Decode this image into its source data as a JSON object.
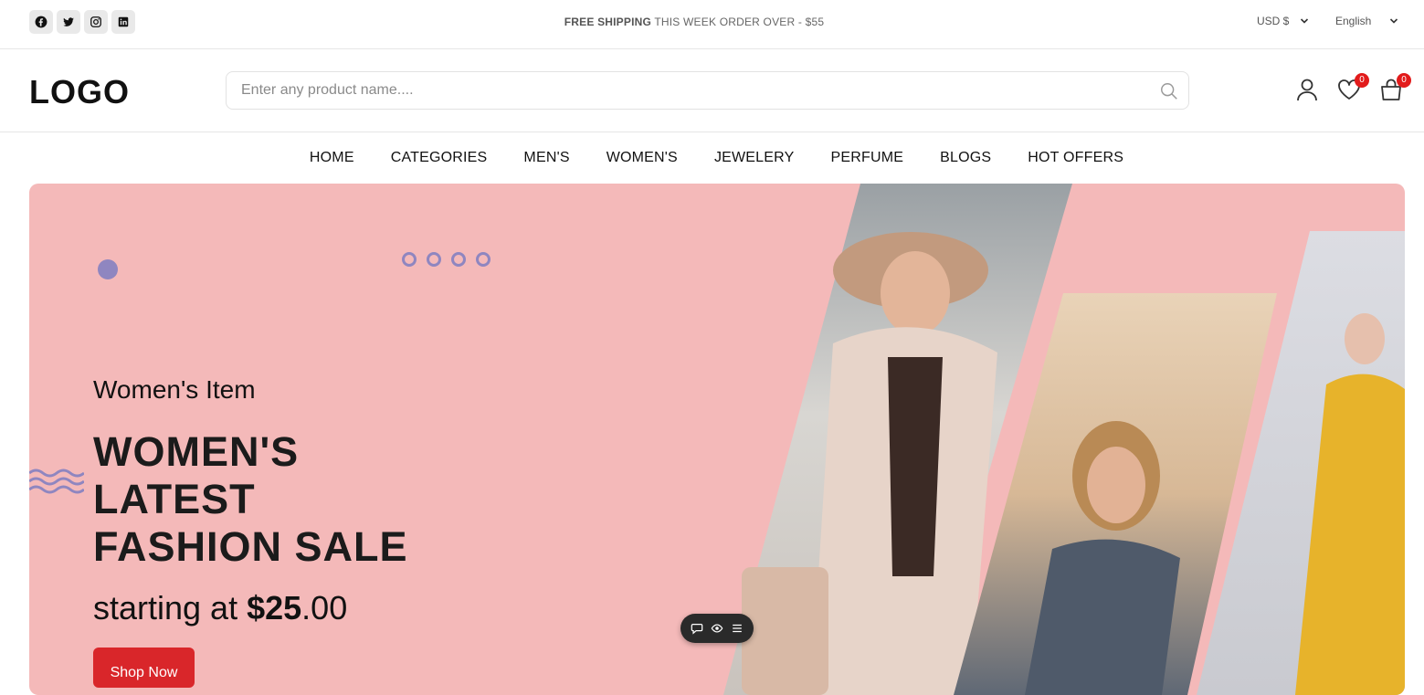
{
  "topbar": {
    "socials": [
      {
        "name": "facebook-icon"
      },
      {
        "name": "twitter-icon"
      },
      {
        "name": "instagram-icon"
      },
      {
        "name": "linkedin-icon"
      }
    ],
    "shipping_bold": "FREE SHIPPING",
    "shipping_text": " THIS WEEK ORDER OVER - $55",
    "currency": "USD $",
    "language": "English"
  },
  "header": {
    "logo": "LOGO",
    "search_placeholder": "Enter any product name....",
    "wishlist_count": "0",
    "cart_count": "0"
  },
  "nav": {
    "items": [
      "HOME",
      "CATEGORIES",
      "MEN'S",
      "WOMEN'S",
      "JEWELERY",
      "PERFUME",
      "BLOGS",
      "HOT OFFERS"
    ]
  },
  "hero": {
    "eyebrow": "Women's Item",
    "headline": [
      "WOMEN'S",
      "LATEST",
      "FASHION SALE"
    ],
    "price_prefix": "starting at ",
    "price_amount": "$25",
    "price_cents": ".00",
    "button": "Shop Now"
  },
  "colors": {
    "hero_bg": "#f4b9b9",
    "accent_purple": "#8f86c0",
    "cta_red": "#d9262a",
    "badge_red": "#e21b1b"
  }
}
